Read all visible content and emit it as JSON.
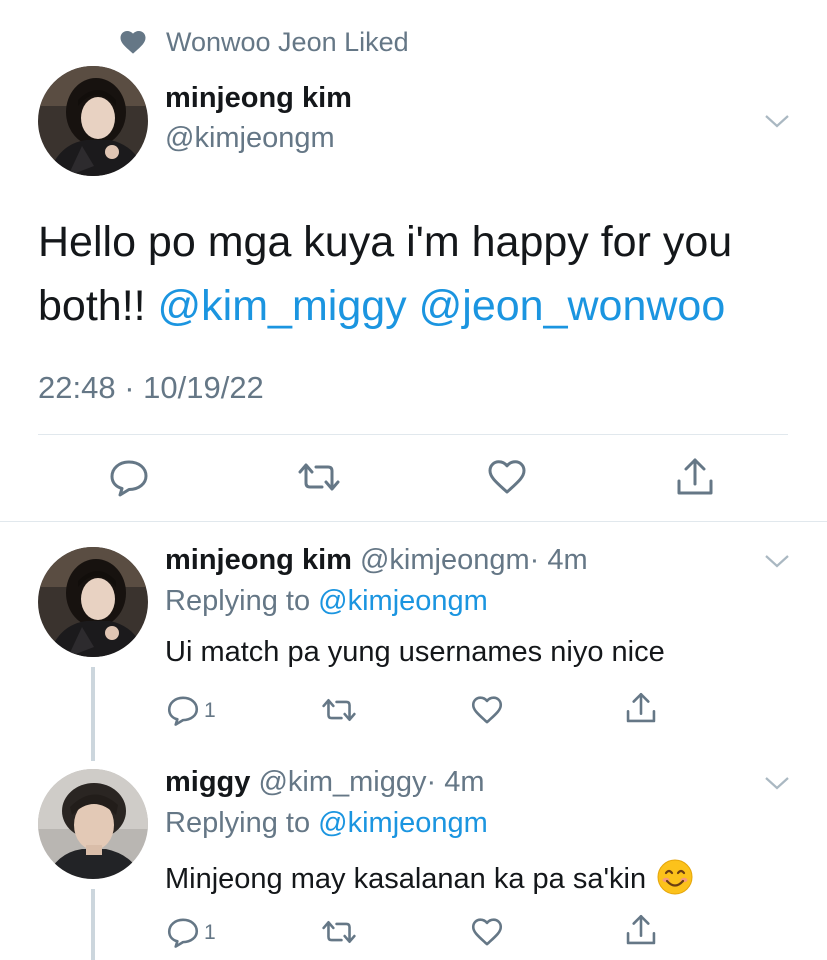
{
  "social_context": {
    "icon": "heart-icon",
    "text": "Wonwoo Jeon Liked"
  },
  "main_tweet": {
    "author": {
      "display_name": "minjeong kim",
      "handle": "@kimjeongm",
      "avatar": "avatar-minjeong"
    },
    "text_prefix": "Hello po mga kuya i'm happy for you both!! ",
    "mentions": [
      "@kim_miggy",
      "@jeon_wonwoo"
    ],
    "timestamp": "22:48 · 10/19/22",
    "actions": [
      "reply-icon",
      "retweet-icon",
      "like-icon",
      "share-icon"
    ]
  },
  "replies": [
    {
      "display_name": "minjeong kim",
      "handle": "@kimjeongm",
      "time": "· 4m",
      "replying_prefix": "Replying to ",
      "replying_to": "@kimjeongm",
      "text": "Ui match pa yung usernames niyo nice",
      "reply_count": "1",
      "avatar": "avatar-minjeong"
    },
    {
      "display_name": "miggy",
      "handle": "@kim_miggy",
      "time": "· 4m",
      "replying_prefix": "Replying to ",
      "replying_to": "@kimjeongm",
      "text": "Minjeong may kasalanan ka pa sa'kin",
      "emoji": "smiling-face-emoji",
      "reply_count": "1",
      "avatar": "avatar-miggy"
    }
  ],
  "colors": {
    "link": "#1b95e0",
    "secondary_text": "#657786",
    "divider": "#e1e8ed",
    "thread_line": "#ccd6dd"
  }
}
